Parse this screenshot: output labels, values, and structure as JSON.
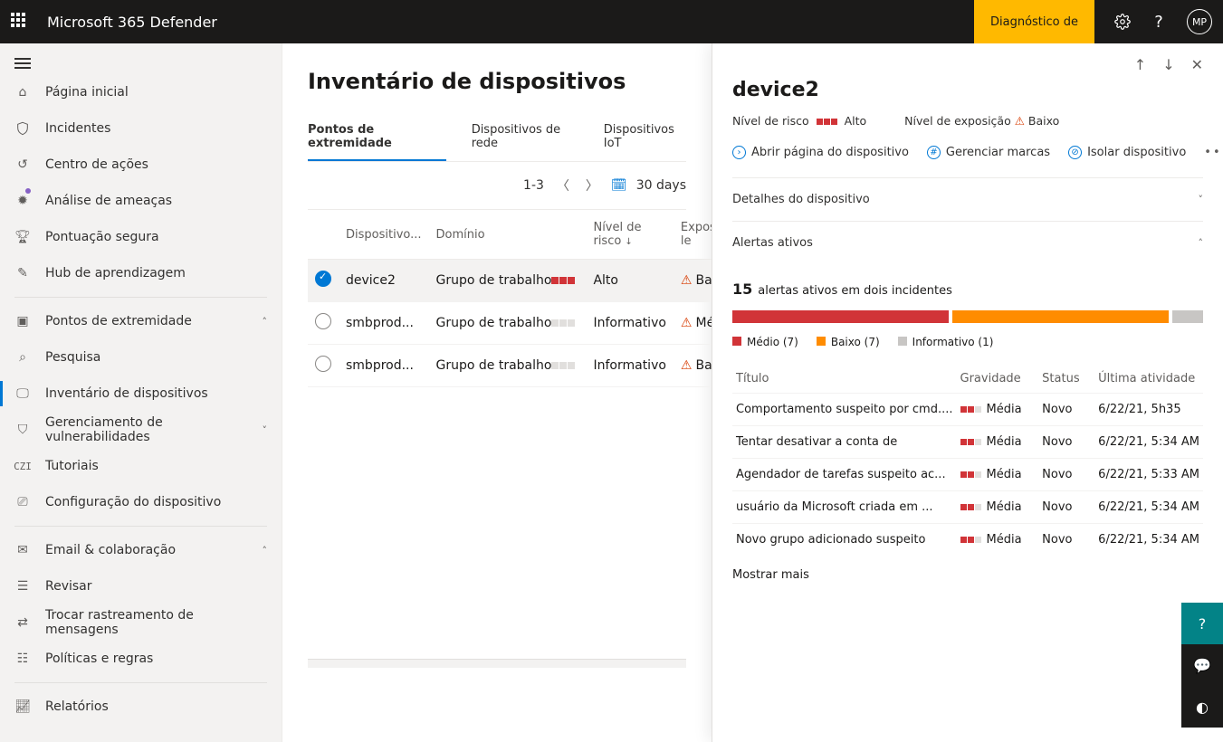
{
  "topbar": {
    "brand": "Microsoft 365 Defender",
    "diagnostic": "Diagnóstico de",
    "avatar": "MP"
  },
  "nav": {
    "items": [
      {
        "label": "Página inicial",
        "icon": "home"
      },
      {
        "label": "Incidentes",
        "icon": "shield"
      },
      {
        "label": "Centro de ações",
        "icon": "history"
      },
      {
        "label": "Análise de ameaças",
        "icon": "bug",
        "dot": true
      },
      {
        "label": "Pontuação segura",
        "icon": "trophy"
      },
      {
        "label": "Hub de aprendizagem",
        "icon": "learn"
      }
    ],
    "sections": [
      {
        "label": "Pontos de extremidade",
        "icon": "endpoint",
        "expand": true,
        "children": [
          {
            "label": "Pesquisa",
            "icon": "search"
          },
          {
            "label": "Inventário de dispositivos",
            "icon": "device",
            "active": true
          },
          {
            "label": "Gerenciamento de vulnerabilidades",
            "icon": "vuln",
            "expand": true
          },
          {
            "label": "Tutoriais",
            "icon": "czi"
          },
          {
            "label": "Configuração do dispositivo",
            "icon": "config"
          }
        ]
      },
      {
        "label": "Email &amp; colaboração",
        "icon": "mail",
        "expand": true,
        "children": [
          {
            "label": "Revisar",
            "icon": "review"
          },
          {
            "label": "Trocar rastreamento de mensagens",
            "icon": "trace"
          },
          {
            "label": "Políticas e regras",
            "icon": "policy"
          }
        ]
      }
    ],
    "footer": {
      "label": "Relatórios",
      "icon": "reports"
    }
  },
  "main": {
    "title": "Inventário de dispositivos",
    "tabs": [
      "Pontos de extremidade",
      "Dispositivos de rede",
      "Dispositivos IoT"
    ],
    "active_tab": 0,
    "range": {
      "text": "1-3",
      "period": "30 days"
    },
    "columns": [
      "Dispositivo...",
      "Domínio",
      "Nível de risco",
      "Exposição le"
    ],
    "rows": [
      {
        "sel": true,
        "device": "device2",
        "domain": "Grupo de trabalho",
        "risk_level": 3,
        "risk": "Alto",
        "exposure": "Baixo"
      },
      {
        "sel": false,
        "device": "smbprod...",
        "domain": "Grupo de trabalho",
        "risk_level": 0,
        "risk": "Informativo",
        "exposure": "Médio"
      },
      {
        "sel": false,
        "device": "smbprod...",
        "domain": "Grupo de trabalho",
        "risk_level": 0,
        "risk": "Informativo",
        "exposure": "Baixo"
      }
    ]
  },
  "panel": {
    "title": "device2",
    "risk_label": "Nível de risco",
    "risk_val": "Alto",
    "exposure_label": "Nível de exposição",
    "exposure_val": "Baixo",
    "actions": {
      "open": "Abrir página do dispositivo",
      "tags": "Gerenciar marcas",
      "isolate": "Isolar dispositivo"
    },
    "device_details_header": "Detalhes do dispositivo",
    "alerts_header": "Alertas ativos",
    "alerts_count_num": "15",
    "alerts_count_text": "alertas ativos em dois incidentes",
    "legend": {
      "medio": "Médio (7)",
      "baixo": "Baixo (7)",
      "info": "Informativo (1)"
    },
    "alert_columns": [
      "Título",
      "Gravidade",
      "Status",
      "Última atividade"
    ],
    "alerts": [
      {
        "title": "Comportamento suspeito por cmd....",
        "sev": "Média",
        "status": "Novo",
        "time": "6/22/21, 5h35"
      },
      {
        "title": "Tentar desativar a conta de",
        "sev": "Média",
        "status": "Novo",
        "time": "6/22/21, 5:34 AM"
      },
      {
        "title": "Agendador de tarefas suspeito ac...",
        "sev": "Média",
        "status": "Novo",
        "time": "6/22/21, 5:33 AM"
      },
      {
        "title": "usuário da Microsoft criada em ...",
        "sev": "Média",
        "status": "Novo",
        "time": "6/22/21, 5:34 AM"
      },
      {
        "title": "Novo grupo adicionado suspeito",
        "sev": "Média",
        "status": "Novo",
        "time": "6/22/21, 5:34 AM"
      }
    ],
    "show_more": "Mostrar mais"
  }
}
